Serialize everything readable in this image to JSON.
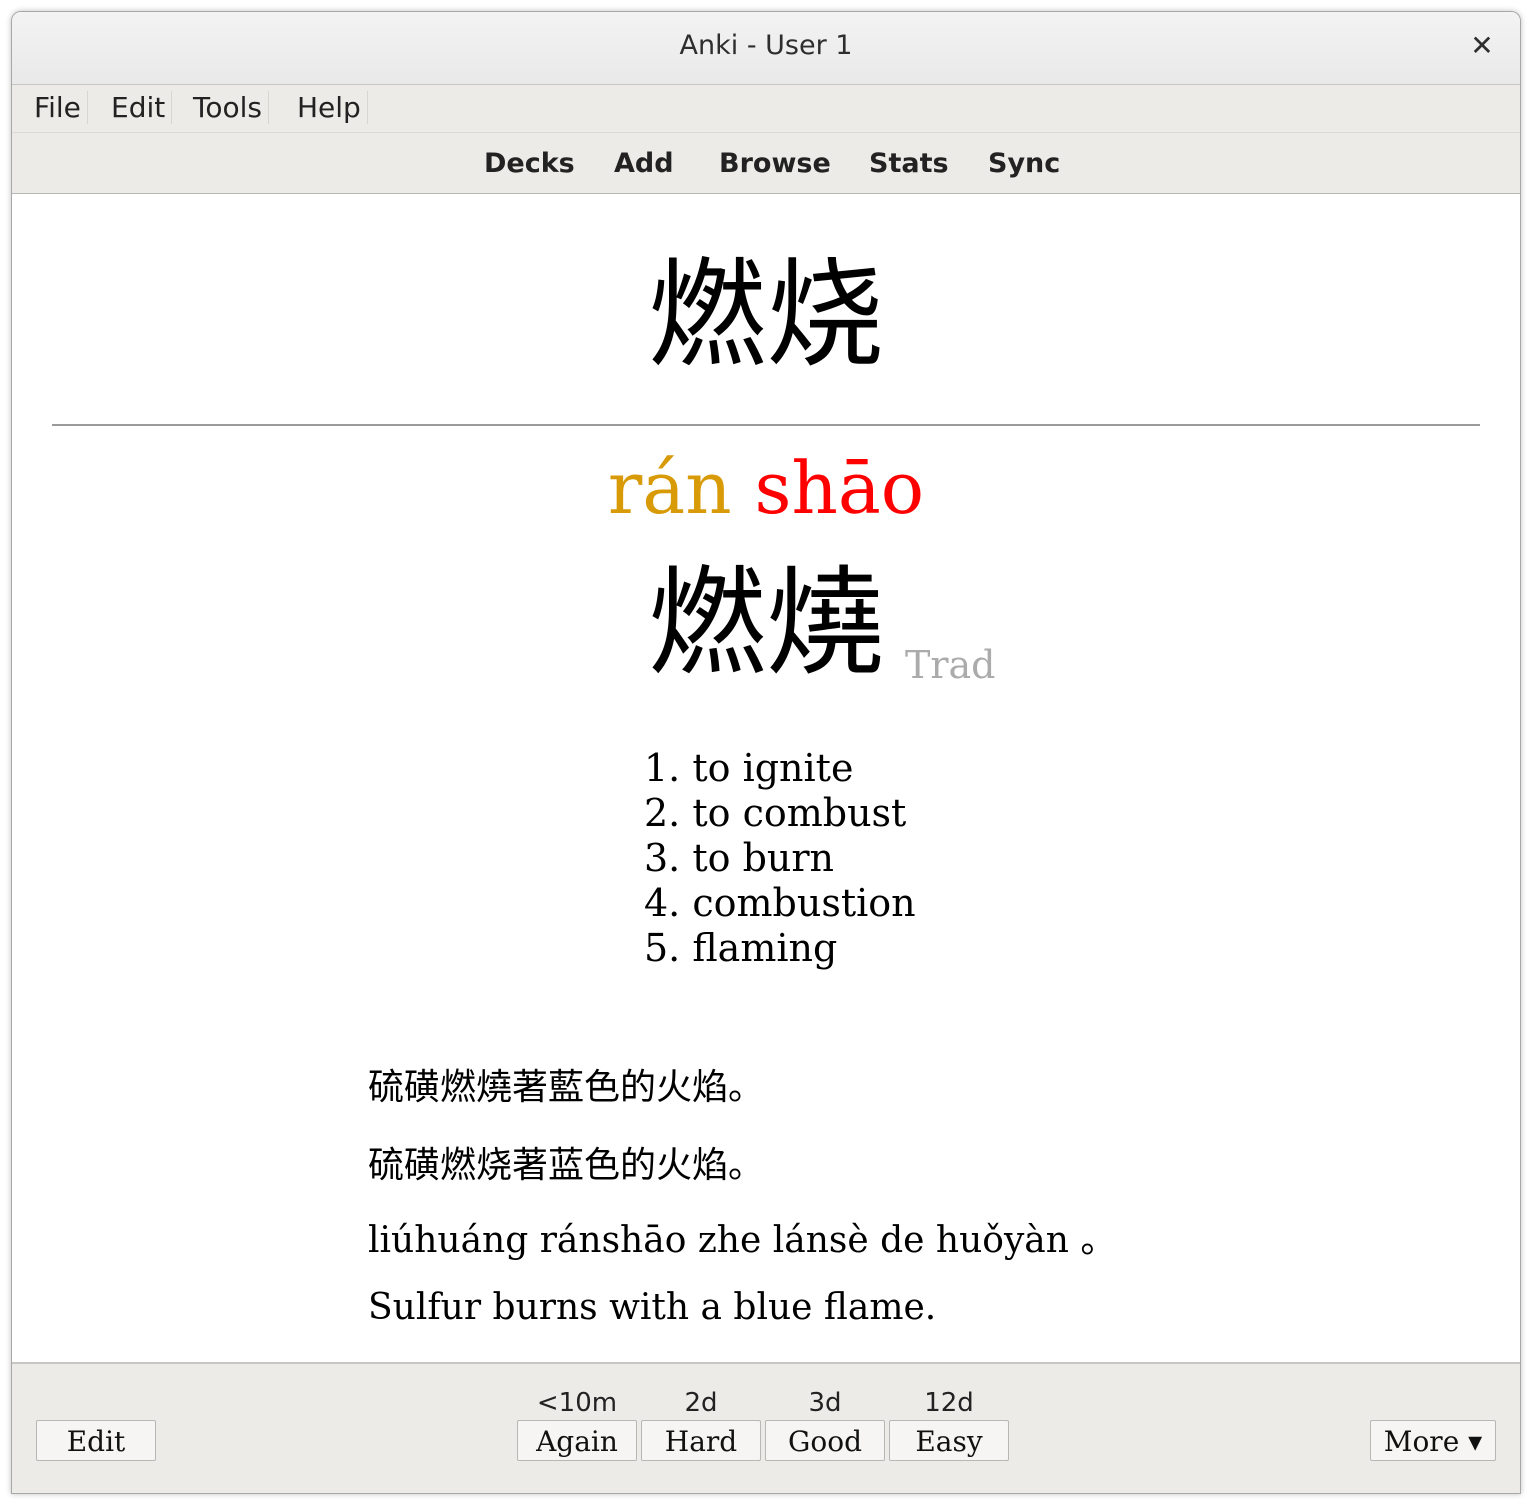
{
  "window": {
    "title": "Anki - User 1",
    "close_glyph": "✕",
    "close_icon": "close-icon"
  },
  "menu": {
    "items": [
      "File",
      "Edit",
      "Tools",
      "Help"
    ]
  },
  "toolbar": {
    "items": [
      "Decks",
      "Add",
      "Browse",
      "Stats",
      "Sync"
    ]
  },
  "card": {
    "front_hanzi": "燃烧",
    "pinyin": [
      {
        "syllable": "rán",
        "tone": 2,
        "color": "#d89b07"
      },
      {
        "syllable": "shāo",
        "tone": 1,
        "color": "#ff0000"
      }
    ],
    "pinyin_separator": " ",
    "traditional": "燃燒",
    "traditional_label": "Trad",
    "definitions": [
      "1. to ignite",
      "2. to combust",
      "3. to burn",
      "4. combustion",
      "5. flaming"
    ],
    "example": {
      "traditional": "硫磺燃燒著藍色的火焰。",
      "simplified": "硫磺燃烧著蓝色的火焰。",
      "pinyin": "liúhuáng ránshāo zhe lánsè de huǒyàn 。",
      "english": "Sulfur burns with a blue flame."
    }
  },
  "footer": {
    "edit_label": "Edit",
    "answers": [
      {
        "label": "Again",
        "interval": "<10m"
      },
      {
        "label": "Hard",
        "interval": "2d"
      },
      {
        "label": "Good",
        "interval": "3d"
      },
      {
        "label": "Easy",
        "interval": "12d"
      }
    ],
    "more_label": "More ▾"
  }
}
